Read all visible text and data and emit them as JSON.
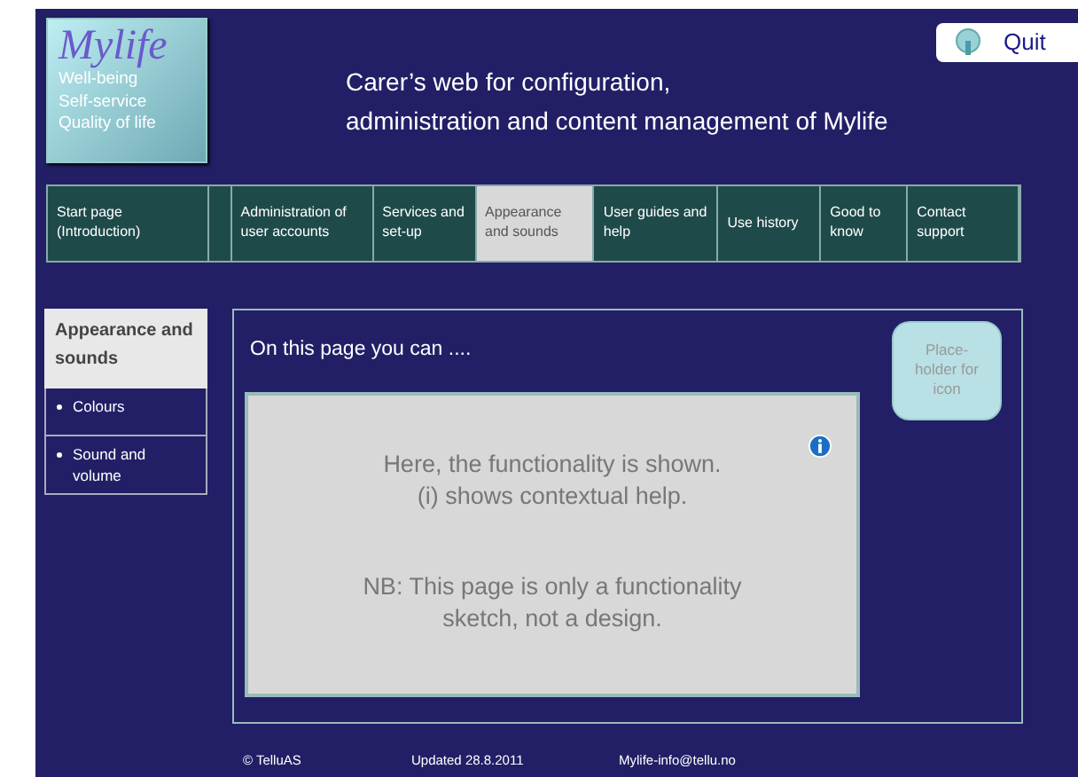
{
  "logo": {
    "title": "Mylife",
    "lines": [
      "Well-being",
      "Self-service",
      "Quality of life"
    ]
  },
  "header": {
    "lines": [
      "Carer’s web for configuration,",
      "administration and content management of Mylife"
    ]
  },
  "quit_button": {
    "label": "Quit"
  },
  "tabs": [
    {
      "label": "Start page (Introduction)",
      "selected": false
    },
    {
      "label": "Administration of user accounts",
      "selected": false
    },
    {
      "label": "Services and set-up",
      "selected": false
    },
    {
      "label": "Appearance and sounds",
      "selected": true
    },
    {
      "label": "User guides and help",
      "selected": false
    },
    {
      "label": "Use history",
      "selected": false
    },
    {
      "label": "Good to know",
      "selected": false
    },
    {
      "label": "Contact support",
      "selected": false
    }
  ],
  "sidebar": {
    "title": "Appearance and sounds",
    "items": [
      {
        "label": "Colours"
      },
      {
        "label": "Sound and volume"
      }
    ]
  },
  "main": {
    "intro": "On this page you can  ....",
    "placeholder_icon": "Place-holder for icon",
    "sketch": {
      "lines": [
        "Here, the functionality is shown.",
        "(i) shows contextual help."
      ],
      "note": [
        "NB: This page is only a functionality",
        "sketch, not a design."
      ]
    }
  },
  "footer": [
    "© TelluAS",
    "Updated 28.8.2011",
    "Mylife-info@tellu.no"
  ]
}
